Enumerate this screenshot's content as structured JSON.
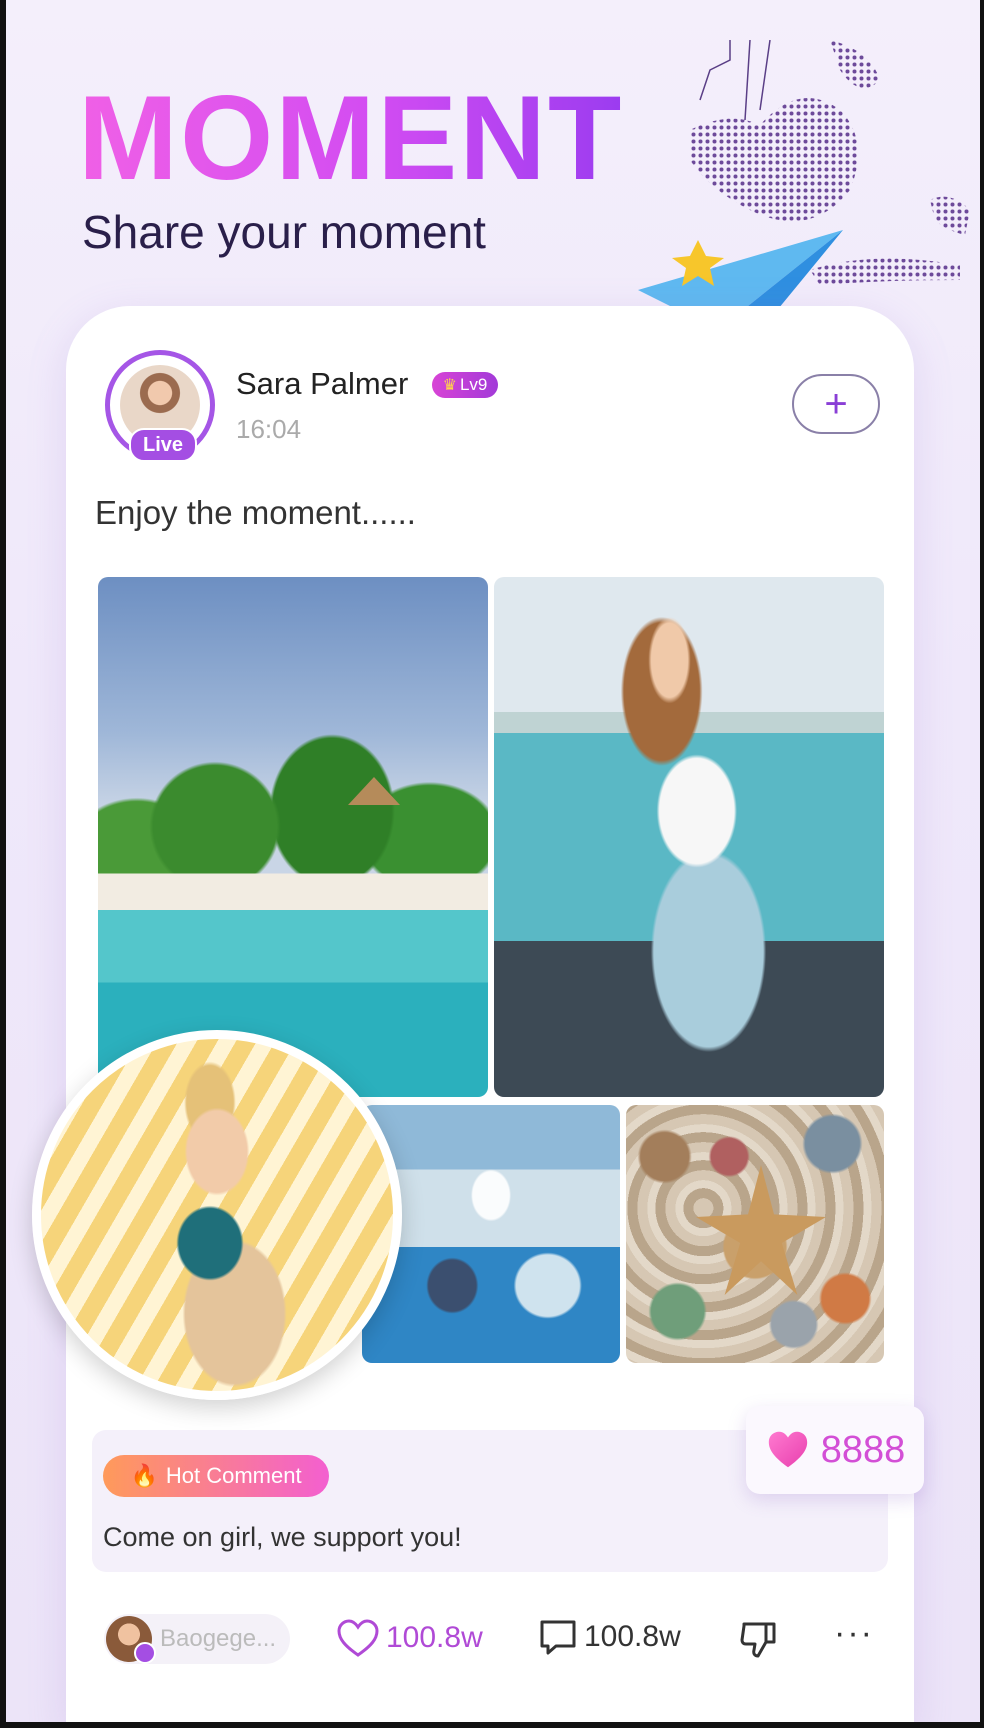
{
  "hero": {
    "title": "MOMENT",
    "subtitle": "Share your moment"
  },
  "post": {
    "author": {
      "name": "Sara Palmer",
      "live_label": "Live",
      "level": "Lv9",
      "avatar_icon": "user-avatar"
    },
    "time": "16:04",
    "follow_label": "+",
    "text": "Enjoy the moment......",
    "photos": [
      "beach-palm-photo",
      "sea-woman-photo",
      "wine-table-photo",
      "shells-starfish-photo",
      "laughing-girl-photo"
    ],
    "like_popup": "8888"
  },
  "hot_comment": {
    "label": "Hot Comment",
    "text": "Come on girl, we support you!"
  },
  "actions": {
    "commenter": "Baogege...",
    "likes": "100.8w",
    "comments": "100.8w",
    "more": "···"
  },
  "colors": {
    "accent": "#a44ee3",
    "title_gradient_start": "#f060e6",
    "title_gradient_end": "#9b3cf0",
    "like": "#d34fd6"
  }
}
